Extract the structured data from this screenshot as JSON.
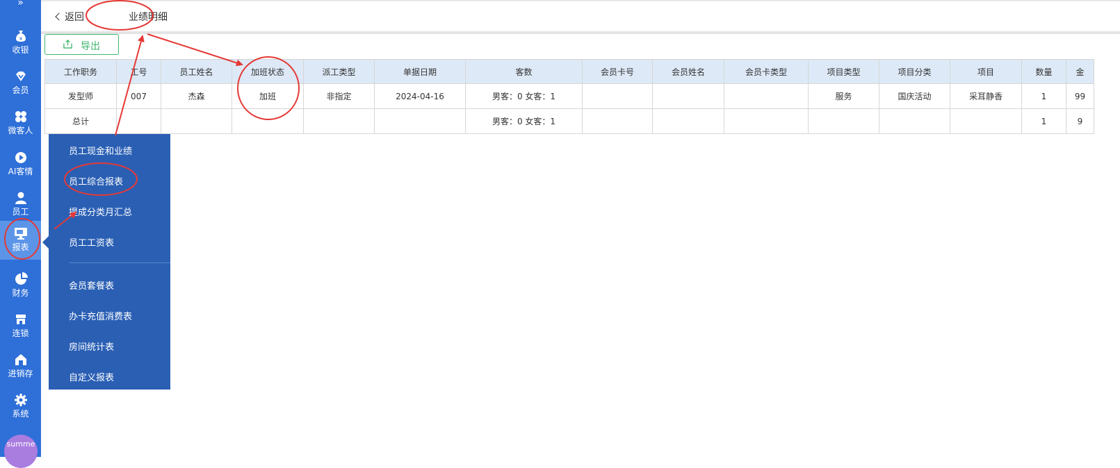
{
  "sidebar": {
    "expand_glyph": "»",
    "items": [
      {
        "label": "收银",
        "icon": "money-bag-icon"
      },
      {
        "label": "会员",
        "icon": "diamond-icon"
      },
      {
        "label": "微客人",
        "icon": "grid-icon"
      },
      {
        "label": "AI客情",
        "icon": "play-icon"
      },
      {
        "label": "员工",
        "icon": "person-icon"
      },
      {
        "label": "报表",
        "icon": "monitor-icon"
      },
      {
        "label": "财务",
        "icon": "pie-icon"
      },
      {
        "label": "连锁",
        "icon": "store-icon"
      },
      {
        "label": "进销存",
        "icon": "warehouse-icon"
      },
      {
        "label": "系统",
        "icon": "gear-icon"
      }
    ],
    "avatar_text": "summe",
    "active_color": "#5c95e8",
    "bg_color": "#2e6fd8"
  },
  "header": {
    "back_label": "返回",
    "title": "业绩明细"
  },
  "toolbar": {
    "export_label": "导出",
    "export_color": "#3fb56b"
  },
  "table": {
    "columns": [
      "工作职务",
      "工号",
      "员工姓名",
      "加班状态",
      "派工类型",
      "单据日期",
      "客数",
      "会员卡号",
      "会员姓名",
      "会员卡类型",
      "项目类型",
      "项目分类",
      "项目",
      "数量",
      "金"
    ],
    "rows": [
      [
        "发型师",
        "007",
        "杰森",
        "加班",
        "非指定",
        "2024-04-16",
        "男客：0 女客：1",
        "",
        "",
        "",
        "服务",
        "国庆活动",
        "采耳静香",
        "1",
        "99"
      ],
      [
        "总计",
        "",
        "",
        "",
        "",
        "",
        "男客：0 女客：1",
        "",
        "",
        "",
        "",
        "",
        "",
        "1",
        "9"
      ]
    ],
    "header_bg": "#dde9f7"
  },
  "menu": {
    "items": [
      "员工现金和业绩",
      "员工综合报表",
      "提成分类月汇总",
      "员工工资表",
      "会员套餐表",
      "办卡充值消费表",
      "房间统计表",
      "自定义报表"
    ],
    "bg_color": "#2a5fb4"
  },
  "annotation_color": "#e53935"
}
